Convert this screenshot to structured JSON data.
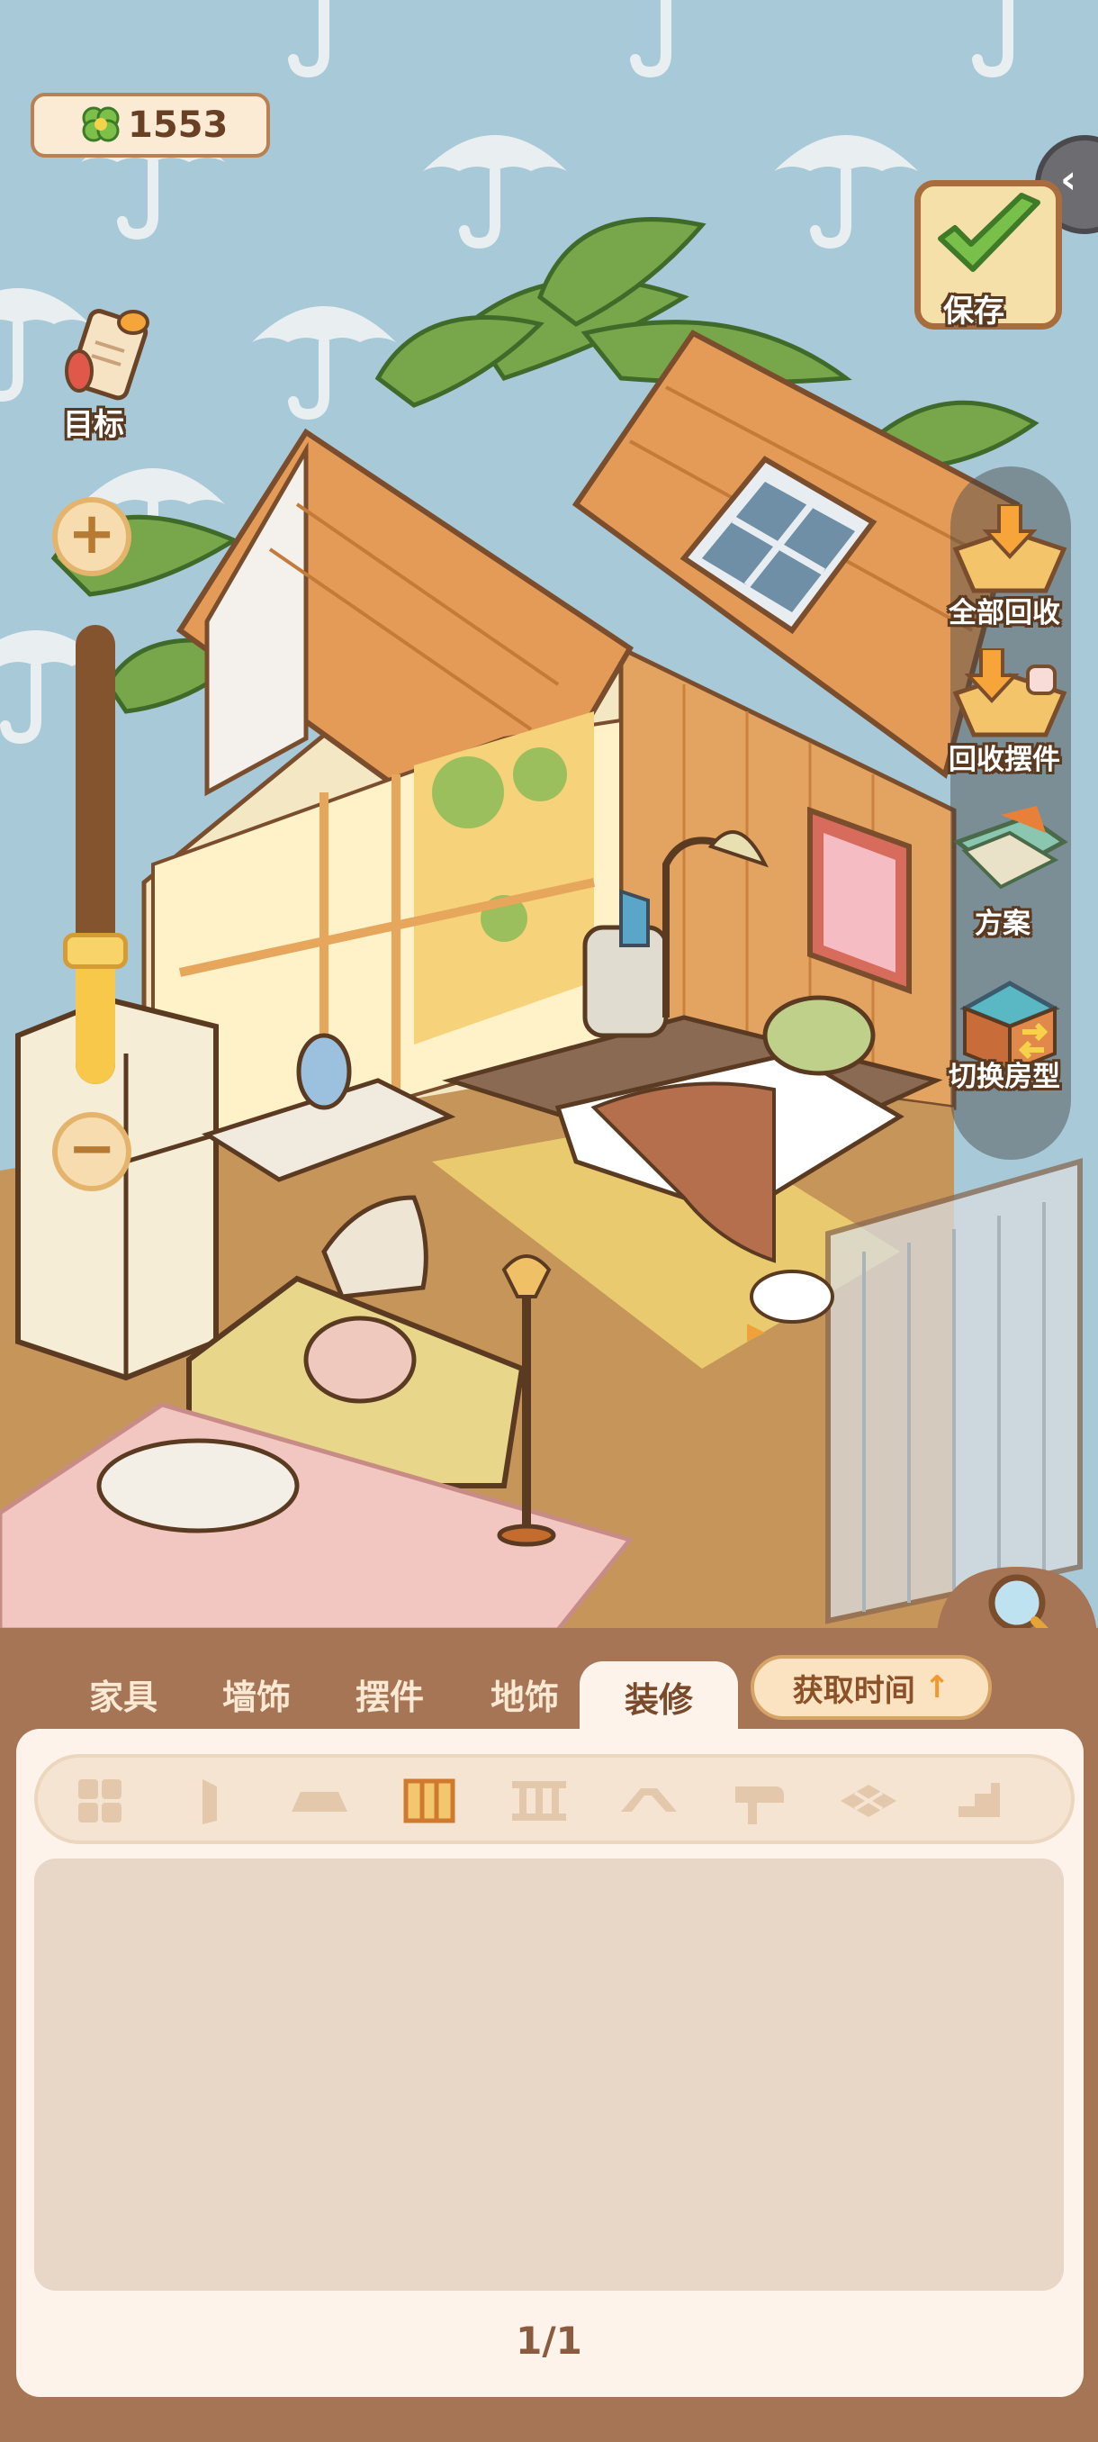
{
  "hud": {
    "currency": {
      "icon": "clover-icon",
      "value": "1553"
    },
    "goal_label": "目标",
    "save_label": "保存",
    "zoom": {
      "level": 0.3
    }
  },
  "right_menu": [
    {
      "label": "全部回收",
      "icon": "recycle-all-icon"
    },
    {
      "label": "回收摆件",
      "icon": "recycle-ornaments-icon"
    },
    {
      "label": "方案",
      "icon": "plan-icon"
    },
    {
      "label": "切换房型",
      "icon": "switch-room-icon"
    }
  ],
  "tabs": [
    {
      "label": "家具",
      "active": false
    },
    {
      "label": "墙饰",
      "active": false
    },
    {
      "label": "摆件",
      "active": false
    },
    {
      "label": "地饰",
      "active": false
    },
    {
      "label": "装修",
      "active": true
    }
  ],
  "time_button": {
    "label": "获取时间",
    "arrow": "↑"
  },
  "subcategories": [
    {
      "icon": "grid-all-icon",
      "active": false
    },
    {
      "icon": "door-icon",
      "active": false
    },
    {
      "icon": "floor-tile-icon",
      "active": false
    },
    {
      "icon": "window-frame-icon",
      "active": true
    },
    {
      "icon": "railing-icon",
      "active": false
    },
    {
      "icon": "roof-icon",
      "active": false
    },
    {
      "icon": "mailbox-icon",
      "active": false
    },
    {
      "icon": "path-stones-icon",
      "active": false
    },
    {
      "icon": "stairs-icon",
      "active": false
    }
  ],
  "pagination": "1/1",
  "colors": {
    "sky": "#a7c9d8",
    "panel_brown": "#a57556",
    "panel_cream": "#fdf3ea",
    "accent_yellow": "#f7c84a"
  }
}
